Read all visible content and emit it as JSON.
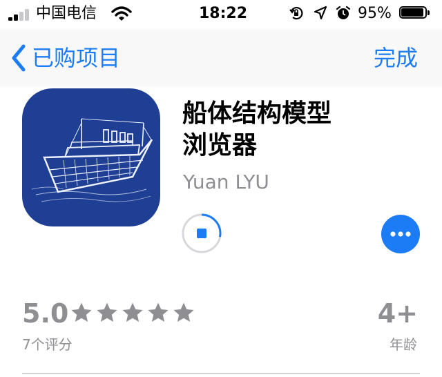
{
  "status_bar": {
    "carrier": "中国电信",
    "time": "18:22",
    "battery": "95%",
    "battery_level": 0.95,
    "signal_bars": 2,
    "icons": [
      "signal-icon",
      "wifi-icon",
      "orientation-lock-icon",
      "location-icon",
      "alarm-icon",
      "battery-icon"
    ]
  },
  "nav": {
    "back_label": "已购项目",
    "done_label": "完成",
    "accent": "#1b7cf6"
  },
  "app": {
    "title": "船体结构模型浏览器",
    "developer": "Yuan LYU",
    "icon": "ship-sketch-icon",
    "icon_bg": "#1f3f94",
    "download_progress": 0.28
  },
  "ratings": {
    "value": "5.0",
    "stars": 5,
    "count_label": "7个评分"
  },
  "age": {
    "value": "4+",
    "label": "年龄"
  }
}
